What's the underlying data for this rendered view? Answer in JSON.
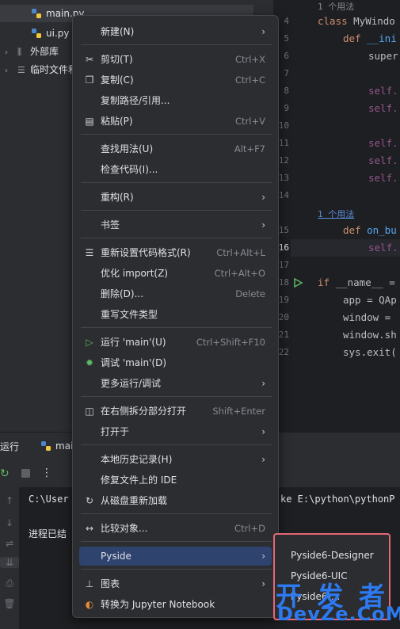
{
  "project_tree": {
    "items": [
      {
        "label": "main.py",
        "type": "file"
      },
      {
        "label": "ui.py",
        "type": "file"
      },
      {
        "label": "外部库",
        "type": "folder"
      },
      {
        "label": "临时文件和",
        "type": "folder"
      }
    ]
  },
  "editor": {
    "line_numbers": [
      "4",
      "5",
      "6",
      "7",
      "8",
      "9",
      "10",
      "11",
      "12",
      "13",
      "14",
      "15",
      "16",
      "17",
      "18",
      "19",
      "20",
      "21",
      "22"
    ],
    "usage_hint_top": "1 个用法",
    "usage_hint_mid": "1 个用法",
    "lines": {
      "l4a": "class ",
      "l4b": "MyWindo",
      "l5a": "def ",
      "l5b": "__ini",
      "l6": "super",
      "l8": "self.",
      "l9": "self.",
      "l11": "self.",
      "l12": "self.",
      "l13": "self.",
      "l15a": "def ",
      "l15b": "on_bu",
      "l16": "self.",
      "l18a": "if ",
      "l18b": "__name__ =",
      "l19": "app = QAp",
      "l20": "window = ",
      "l21": "window.sh",
      "l22": "sys.exit("
    }
  },
  "run_panel": {
    "tab_run": "运行",
    "tab_file": "mai",
    "console_line1": "C:\\User",
    "console_line1_right": "ke E:\\python\\pythonP",
    "console_line2": "进程已结"
  },
  "context_menu": {
    "items": [
      {
        "icon": "",
        "label": "新建(N)",
        "shortcut": "",
        "submenu": true
      },
      {
        "icon": "scissors-icon",
        "glyph": "✂",
        "label": "剪切(T)",
        "shortcut": "Ctrl+X"
      },
      {
        "icon": "copy-icon",
        "glyph": "❐",
        "label": "复制(C)",
        "shortcut": "Ctrl+C"
      },
      {
        "icon": "",
        "label": "复制路径/引用...",
        "shortcut": ""
      },
      {
        "icon": "paste-icon",
        "glyph": "▤",
        "label": "粘贴(P)",
        "shortcut": "Ctrl+V"
      },
      {
        "icon": "",
        "label": "查找用法(U)",
        "shortcut": "Alt+F7"
      },
      {
        "icon": "",
        "label": "检查代码(I)...",
        "shortcut": ""
      },
      {
        "icon": "",
        "label": "重构(R)",
        "shortcut": "",
        "submenu": true
      },
      {
        "icon": "",
        "label": "书签",
        "shortcut": "",
        "submenu": true
      },
      {
        "icon": "reformat-icon",
        "glyph": "☰",
        "label": "重新设置代码格式(R)",
        "shortcut": "Ctrl+Alt+L"
      },
      {
        "icon": "",
        "label": "优化 import(Z)",
        "shortcut": "Ctrl+Alt+O"
      },
      {
        "icon": "",
        "label": "删除(D)...",
        "shortcut": "Delete"
      },
      {
        "icon": "",
        "label": "重写文件类型",
        "shortcut": ""
      },
      {
        "icon": "run-icon",
        "glyph": "▷",
        "label": "运行 'main'(U)",
        "shortcut": "Ctrl+Shift+F10"
      },
      {
        "icon": "debug-icon",
        "glyph": "✹",
        "label": "调试 'main'(D)",
        "shortcut": ""
      },
      {
        "icon": "",
        "label": "更多运行/调试",
        "shortcut": "",
        "submenu": true
      },
      {
        "icon": "split-icon",
        "glyph": "◫",
        "label": "在右侧拆分部分打开",
        "shortcut": "Shift+Enter"
      },
      {
        "icon": "",
        "label": "打开于",
        "shortcut": "",
        "submenu": true
      },
      {
        "icon": "",
        "label": "本地历史记录(H)",
        "shortcut": "",
        "submenu": true
      },
      {
        "icon": "",
        "label": "修复文件上的 IDE",
        "shortcut": ""
      },
      {
        "icon": "reload-icon",
        "glyph": "↻",
        "label": "从磁盘重新加载",
        "shortcut": ""
      },
      {
        "icon": "compare-icon",
        "glyph": "↔",
        "label": "比较对象...",
        "shortcut": "Ctrl+D"
      },
      {
        "icon": "",
        "label": "Pyside",
        "shortcut": "",
        "submenu": true,
        "selected": true
      },
      {
        "icon": "diagram-icon",
        "glyph": "⊥",
        "label": "图表",
        "shortcut": "",
        "submenu": true
      },
      {
        "icon": "jupyter-icon",
        "glyph": "◐",
        "label": "转换为 Jupyter Notebook",
        "shortcut": ""
      }
    ]
  },
  "submenu": {
    "items": [
      "Pyside6-Designer",
      "Pyside6-UIC",
      "Pyside6-..."
    ]
  },
  "watermark": {
    "line1": "开 发 者",
    "line2": "DevZe.CoM"
  },
  "colors": {
    "accent": "#2e436e",
    "highlight_border": "#e46876",
    "watermark": "#2d7af0"
  }
}
